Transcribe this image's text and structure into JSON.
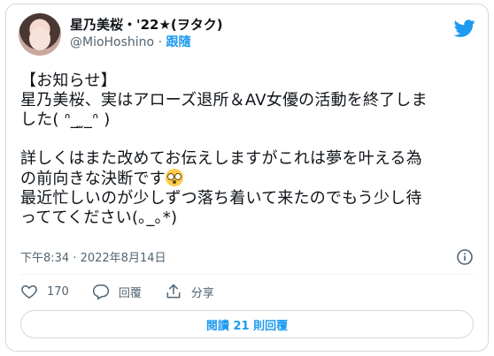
{
  "tweet": {
    "author": {
      "display_name": "星乃美桜・'22★(ヲタク)",
      "handle": "@MioHoshino",
      "separator": " · ",
      "follow_label": "跟隨"
    },
    "body": {
      "line1": "【お知らせ】",
      "line2": "星乃美桜、実はアローズ退所＆AV女優の活動を終了しま",
      "line3": "した( ᐢ_ ̫_ᐢ )",
      "line4": "",
      "line5": "詳しくはまた改めてお伝えしますがこれは夢を叶える為",
      "line6": "の前向きな決断です",
      "line7": "最近忙しいのが少しずつ落ち着いて来たのでもう少し待",
      "line8": "っててください(｡_｡*)"
    },
    "timestamp": "下午8:34 · 2022年8月14日",
    "actions": {
      "like_count": "170",
      "reply_label": "回覆",
      "share_label": "分享"
    },
    "read_replies_label": "閱讀 21 則回覆"
  },
  "icons": {
    "brand": "twitter-bird-icon",
    "info": "info-icon",
    "like": "heart-icon",
    "reply": "reply-icon",
    "share": "share-icon",
    "emoji": "flushed-face-emoji"
  },
  "colors": {
    "brand": "#1d9bf0",
    "text": "#0f1419",
    "secondary": "#536471",
    "border": "#cfd9de"
  }
}
